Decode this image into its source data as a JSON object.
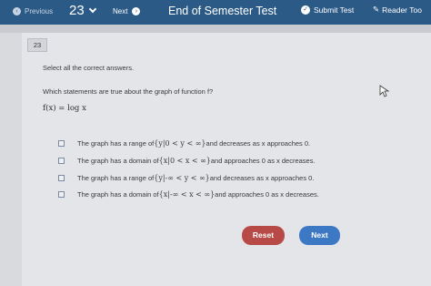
{
  "topbar": {
    "previous_label": "Previous",
    "question_number": "23",
    "next_label": "Next",
    "test_title": "End of Semester Test",
    "submit_label": "Submit Test",
    "reader_label": "Reader Too",
    "bar_color": "#2c5a86"
  },
  "question": {
    "badge": "23",
    "instruction": "Select all the correct answers.",
    "prompt": "Which statements are true about the graph of function f?",
    "function_text": "f(x) = log x",
    "options": [
      {
        "prefix": "The graph has a range of ",
        "math": "{y|0 < y < ∞}",
        "suffix": " and decreases as x approaches 0."
      },
      {
        "prefix": "The graph has a domain of ",
        "math": "{x|0 < x < ∞}",
        "suffix": " and approaches 0 as x decreases."
      },
      {
        "prefix": "The graph has a range of ",
        "math": "{y|-∞ < y < ∞}",
        "suffix": " and decreases as x approaches 0."
      },
      {
        "prefix": "The graph has a domain of ",
        "math": "{x|-∞ < x < ∞}",
        "suffix": " and approaches 0 as x decreases."
      }
    ]
  },
  "buttons": {
    "reset_label": "Reset",
    "next_label": "Next",
    "reset_color": "#b74a47",
    "next_color": "#3d78c4"
  }
}
